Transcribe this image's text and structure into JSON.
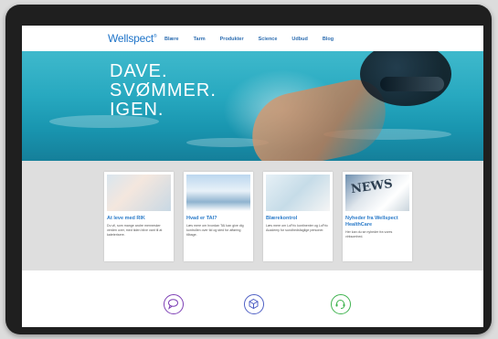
{
  "nav": {
    "logo": "Wellspect",
    "items": [
      "Blære",
      "Tarm",
      "Produkter",
      "Science",
      "Udbud",
      "Blog"
    ]
  },
  "hero": {
    "lines": [
      "DAVE.",
      "SVØMMER.",
      "IGEN."
    ]
  },
  "cards": [
    {
      "title": "At leve med RIK",
      "desc": "Du vil, som mange andre mennesker verden over, med tiden blive vant til at kateterisere."
    },
    {
      "title": "Hvad er TAI?",
      "desc": "Læs mere om hvordan TAI kan give dig kontrollen over tid og sted for afføring tilbage."
    },
    {
      "title": "Blærekontrol",
      "desc": "Læs mere om LoFric kontinenter og LoFric Academy for sundhedsfaglige personer."
    },
    {
      "title": "Nyheder fra Wellspect HealthCare",
      "desc": "Her kan du se nyheder fra vores virksomhed.",
      "image_text": "NEWS"
    }
  ],
  "colors": {
    "brand": "#1f74c9",
    "nav_text": "#2b6cb0",
    "icon_purple": "#7d3fb5",
    "icon_blue": "#4e5fc4",
    "icon_green": "#3fb34f"
  },
  "icons": [
    "speech-bubble-icon",
    "cube-icon",
    "headset-icon"
  ]
}
